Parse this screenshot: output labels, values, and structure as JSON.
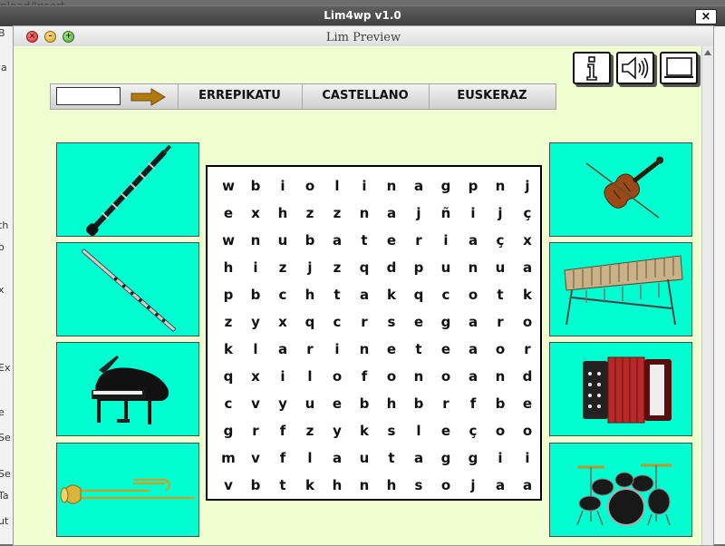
{
  "background": {
    "top_text": "pload/Insert",
    "left_letters": [
      "B",
      "la",
      "th",
      "o",
      "x",
      "Ex",
      "e",
      "Se",
      "Se",
      "Ta",
      "ut"
    ]
  },
  "outer_window": {
    "title": "Lim4wp v1.0",
    "close_label": "×"
  },
  "inner_window": {
    "title": "Lim Preview"
  },
  "traffic_lights": {
    "close_glyph": "×",
    "minimize_glyph": "–",
    "maximize_glyph": "+"
  },
  "toolbar": {
    "icons": [
      "info-icon",
      "speaker-icon",
      "monitor-icon"
    ]
  },
  "controls": {
    "input_value": "",
    "go_icon": "arrow-right-icon",
    "repeat_label": "ERREPIKATU",
    "spanish_label": "CASTELLANO",
    "basque_label": "EUSKERAZ"
  },
  "instruments": {
    "left": [
      "clarinet",
      "flute",
      "grand-piano",
      "trombone"
    ],
    "right": [
      "violin",
      "xylophone",
      "accordion",
      "drum-kit"
    ]
  },
  "colors": {
    "card": "#00ffd0",
    "content_bg": "#f0ffd0",
    "arrow": "#b07a10"
  },
  "grid": {
    "rows": [
      [
        "w",
        "b",
        "i",
        "o",
        "l",
        "i",
        "n",
        "a",
        "g",
        "p",
        "n",
        "j"
      ],
      [
        "e",
        "x",
        "h",
        "z",
        "z",
        "n",
        "a",
        "j",
        "ñ",
        "i",
        "j",
        "ç"
      ],
      [
        "w",
        "n",
        "u",
        "b",
        "a",
        "t",
        "e",
        "r",
        "i",
        "a",
        "ç",
        "x"
      ],
      [
        "h",
        "i",
        "z",
        "j",
        "z",
        "q",
        "d",
        "p",
        "u",
        "n",
        "u",
        "a"
      ],
      [
        "p",
        "b",
        "c",
        "h",
        "t",
        "a",
        "k",
        "q",
        "c",
        "o",
        "t",
        "k"
      ],
      [
        "z",
        "y",
        "x",
        "q",
        "c",
        "r",
        "s",
        "e",
        "g",
        "a",
        "r",
        "o"
      ],
      [
        "k",
        "l",
        "a",
        "r",
        "i",
        "n",
        "e",
        "t",
        "e",
        "a",
        "o",
        "r"
      ],
      [
        "q",
        "x",
        "i",
        "l",
        "o",
        "f",
        "o",
        "n",
        "o",
        "a",
        "n",
        "d"
      ],
      [
        "c",
        "v",
        "y",
        "u",
        "e",
        "b",
        "h",
        "b",
        "r",
        "f",
        "b",
        "e"
      ],
      [
        "g",
        "r",
        "f",
        "z",
        "y",
        "k",
        "s",
        "l",
        "e",
        "ç",
        "o",
        "o"
      ],
      [
        "m",
        "v",
        "f",
        "l",
        "a",
        "u",
        "t",
        "a",
        "g",
        "g",
        "i",
        "i"
      ],
      [
        "v",
        "b",
        "t",
        "k",
        "h",
        "n",
        "h",
        "s",
        "o",
        "j",
        "a",
        "a"
      ]
    ]
  }
}
